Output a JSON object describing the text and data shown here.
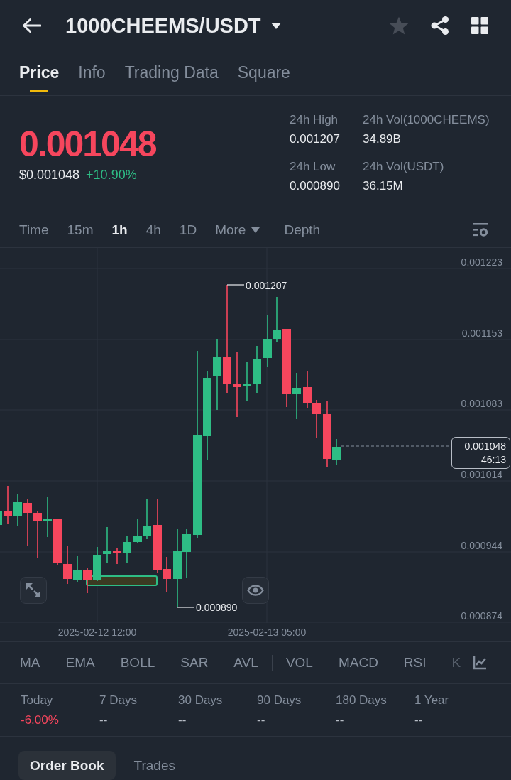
{
  "header": {
    "title": "1000CHEEMS/USDT",
    "favorite": false
  },
  "tabs": [
    {
      "label": "Price",
      "selected": true
    },
    {
      "label": "Info",
      "selected": false
    },
    {
      "label": "Trading Data",
      "selected": false
    },
    {
      "label": "Square",
      "selected": false
    }
  ],
  "ticker": {
    "last_price": "0.001048",
    "price_falling": true,
    "usd_price": "$0.001048",
    "change": "+10.90%",
    "change_positive": true,
    "stats": [
      {
        "label": "24h High",
        "value": "0.001207"
      },
      {
        "label": "24h Vol(1000CHEEMS)",
        "value": "34.89B"
      },
      {
        "label": "24h Low",
        "value": "0.000890"
      },
      {
        "label": "24h Vol(USDT)",
        "value": "36.15M"
      }
    ]
  },
  "intervals": [
    {
      "label": "Time",
      "kind": "interval",
      "selected": false
    },
    {
      "label": "15m",
      "kind": "interval",
      "selected": false
    },
    {
      "label": "1h",
      "kind": "interval",
      "selected": true
    },
    {
      "label": "4h",
      "kind": "interval",
      "selected": false
    },
    {
      "label": "1D",
      "kind": "interval",
      "selected": false
    },
    {
      "label": "More",
      "kind": "menu",
      "selected": false
    },
    {
      "label": "Depth",
      "kind": "view",
      "selected": false
    }
  ],
  "chart": {
    "price_labels": [
      "0.001223",
      "0.001153",
      "0.001083",
      "0.001014",
      "0.000944",
      "0.000874"
    ],
    "time_labels": [
      "2025-02-12 12:00",
      "2025-02-13 05:00"
    ],
    "high_marker": "0.001207",
    "low_marker": "0.000890",
    "last_price_tag": {
      "price": "0.001048",
      "countdown": "46:13"
    }
  },
  "indicators": {
    "main": [
      "MA",
      "EMA",
      "BOLL",
      "SAR",
      "AVL"
    ],
    "sub": [
      "VOL",
      "MACD",
      "RSI",
      "K"
    ]
  },
  "performance": [
    {
      "period": "Today",
      "value": "-6.00%",
      "kind": "loss"
    },
    {
      "period": "7 Days",
      "value": "--",
      "kind": "empty"
    },
    {
      "period": "30 Days",
      "value": "--",
      "kind": "empty"
    },
    {
      "period": "90 Days",
      "value": "--",
      "kind": "empty"
    },
    {
      "period": "180 Days",
      "value": "--",
      "kind": "empty"
    },
    {
      "period": "1 Year",
      "value": "--",
      "kind": "empty"
    }
  ],
  "bottom_tabs": [
    {
      "label": "Order Book",
      "selected": true
    },
    {
      "label": "Trades",
      "selected": false
    }
  ]
}
